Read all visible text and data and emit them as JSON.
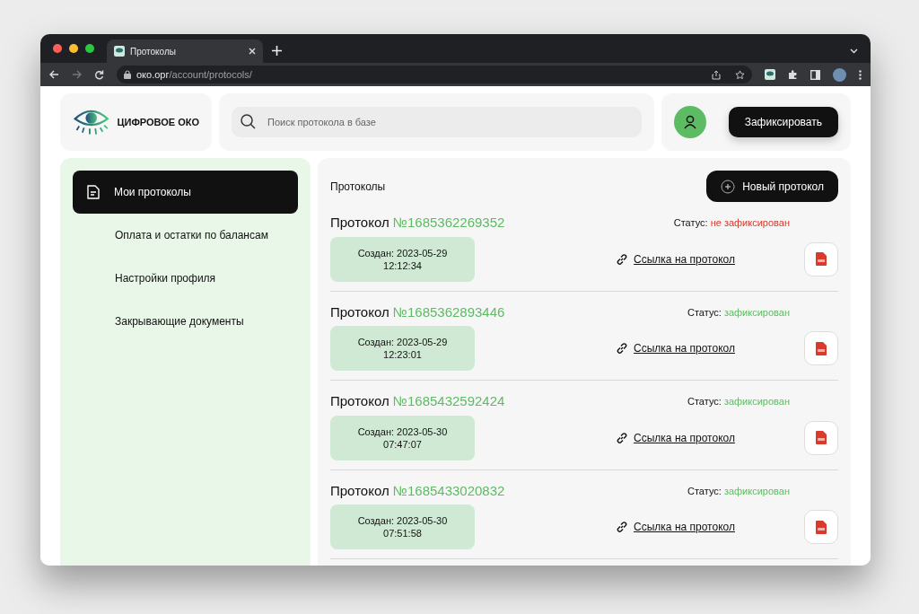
{
  "browser": {
    "tab_title": "Протоколы",
    "address_host": "око.орг",
    "address_path": "/account/protocols/"
  },
  "header": {
    "logo_text": "ЦИФРОВОЕ ОКО",
    "search": {
      "placeholder": "Поиск протокола в базе"
    },
    "action_button": "Зафиксировать"
  },
  "sidebar": {
    "items": [
      {
        "label": "Мои протоколы",
        "selected": true
      },
      {
        "label": "Оплата и остатки по балансам",
        "selected": false
      },
      {
        "label": "Настройки профиля",
        "selected": false
      },
      {
        "label": "Закрывающие документы",
        "selected": false
      }
    ]
  },
  "main": {
    "title": "Протоколы",
    "new_button": "Новый протокол",
    "protocols": [
      {
        "prefix": "Протокол",
        "number": "№1685362269352",
        "status_label": "Статус:",
        "status": "не зафиксирован",
        "fixed": false,
        "created": "Создан: 2023-05-29",
        "time": "12:12:34",
        "link": "Ссылка на протокол"
      },
      {
        "prefix": "Протокол",
        "number": "№1685362893446",
        "status_label": "Статус:",
        "status": "зафиксирован",
        "fixed": true,
        "created": "Создан: 2023-05-29",
        "time": "12:23:01",
        "link": "Ссылка на протокол"
      },
      {
        "prefix": "Протокол",
        "number": "№1685432592424",
        "status_label": "Статус:",
        "status": "зафиксирован",
        "fixed": true,
        "created": "Создан: 2023-05-30",
        "time": "07:47:07",
        "link": "Ссылка на протокол"
      },
      {
        "prefix": "Протокол",
        "number": "№1685433020832",
        "status_label": "Статус:",
        "status": "зафиксирован",
        "fixed": true,
        "created": "Создан: 2023-05-30",
        "time": "07:51:58",
        "link": "Ссылка на протокол"
      }
    ]
  }
}
